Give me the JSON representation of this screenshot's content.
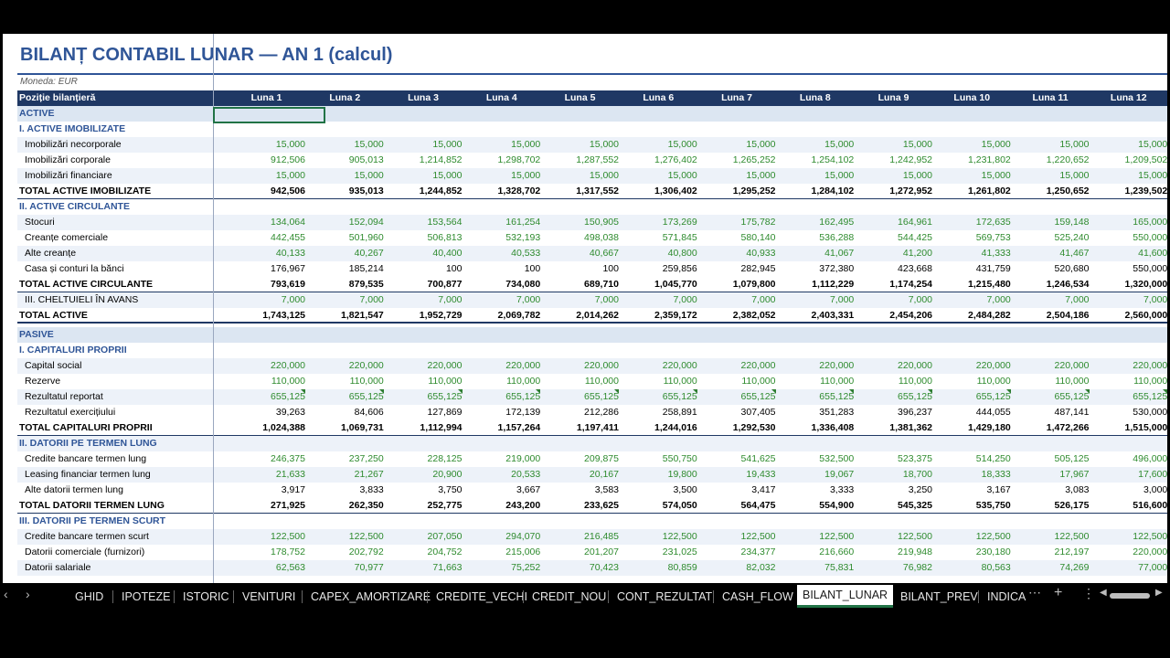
{
  "title": "BILANȚ CONTABIL LUNAR — AN 1 (calcul)",
  "currency": "Moneda: EUR",
  "header_label": "Poziție bilanțieră",
  "months": [
    "Luna 1",
    "Luna 2",
    "Luna 3",
    "Luna 4",
    "Luna 5",
    "Luna 6",
    "Luna 7",
    "Luna 8",
    "Luna 9",
    "Luna 10",
    "Luna 11",
    "Luna 12"
  ],
  "rows": [
    {
      "type": "sec",
      "label": "ACTIVE",
      "values": []
    },
    {
      "type": "sub",
      "label": "I. ACTIVE IMOBILIZATE",
      "values": []
    },
    {
      "type": "inp",
      "band": true,
      "label": "Imobilizări necorporale",
      "values": [
        "15,000",
        "15,000",
        "15,000",
        "15,000",
        "15,000",
        "15,000",
        "15,000",
        "15,000",
        "15,000",
        "15,000",
        "15,000",
        "15,000"
      ]
    },
    {
      "type": "inp",
      "label": "Imobilizări corporale",
      "values": [
        "912,506",
        "905,013",
        "1,214,852",
        "1,298,702",
        "1,287,552",
        "1,276,402",
        "1,265,252",
        "1,254,102",
        "1,242,952",
        "1,231,802",
        "1,220,652",
        "1,209,502"
      ]
    },
    {
      "type": "inp",
      "band": true,
      "label": "Imobilizări financiare",
      "values": [
        "15,000",
        "15,000",
        "15,000",
        "15,000",
        "15,000",
        "15,000",
        "15,000",
        "15,000",
        "15,000",
        "15,000",
        "15,000",
        "15,000"
      ]
    },
    {
      "type": "tot",
      "label": "TOTAL ACTIVE IMOBILIZATE",
      "values": [
        "942,506",
        "935,013",
        "1,244,852",
        "1,328,702",
        "1,317,552",
        "1,306,402",
        "1,295,252",
        "1,284,102",
        "1,272,952",
        "1,261,802",
        "1,250,652",
        "1,239,502"
      ]
    },
    {
      "type": "sub",
      "label": "II. ACTIVE CIRCULANTE",
      "values": []
    },
    {
      "type": "inp",
      "band": true,
      "label": "Stocuri",
      "values": [
        "134,064",
        "152,094",
        "153,564",
        "161,254",
        "150,905",
        "173,269",
        "175,782",
        "162,495",
        "164,961",
        "172,635",
        "159,148",
        "165,000"
      ]
    },
    {
      "type": "inp",
      "label": "Creanțe comerciale",
      "values": [
        "442,455",
        "501,960",
        "506,813",
        "532,193",
        "498,038",
        "571,845",
        "580,140",
        "536,288",
        "544,425",
        "569,753",
        "525,240",
        "550,000"
      ]
    },
    {
      "type": "inp",
      "band": true,
      "label": "Alte creanțe",
      "values": [
        "40,133",
        "40,267",
        "40,400",
        "40,533",
        "40,667",
        "40,800",
        "40,933",
        "41,067",
        "41,200",
        "41,333",
        "41,467",
        "41,600"
      ]
    },
    {
      "type": "calc",
      "label": "Casa și conturi la bănci",
      "values": [
        "176,967",
        "185,214",
        "100",
        "100",
        "100",
        "259,856",
        "282,945",
        "372,380",
        "423,668",
        "431,759",
        "520,680",
        "550,000"
      ]
    },
    {
      "type": "tot",
      "label": "TOTAL ACTIVE CIRCULANTE",
      "values": [
        "793,619",
        "879,535",
        "700,877",
        "734,080",
        "689,710",
        "1,045,770",
        "1,079,800",
        "1,112,229",
        "1,174,254",
        "1,215,480",
        "1,246,534",
        "1,320,000"
      ]
    },
    {
      "type": "inp",
      "band": true,
      "label": "III. CHELTUIELI ÎN AVANS",
      "values": [
        "7,000",
        "7,000",
        "7,000",
        "7,000",
        "7,000",
        "7,000",
        "7,000",
        "7,000",
        "7,000",
        "7,000",
        "7,000",
        "7,000"
      ]
    },
    {
      "type": "tot2",
      "label": "TOTAL ACTIVE",
      "values": [
        "1,743,125",
        "1,821,547",
        "1,952,729",
        "2,069,782",
        "2,014,262",
        "2,359,172",
        "2,382,052",
        "2,403,331",
        "2,454,206",
        "2,484,282",
        "2,504,186",
        "2,560,000"
      ]
    },
    {
      "type": "gap",
      "label": "",
      "values": []
    },
    {
      "type": "sec",
      "label": "PASIVE",
      "values": []
    },
    {
      "type": "sub",
      "label": "I. CAPITALURI PROPRII",
      "values": []
    },
    {
      "type": "inp",
      "band": true,
      "label": "Capital social",
      "values": [
        "220,000",
        "220,000",
        "220,000",
        "220,000",
        "220,000",
        "220,000",
        "220,000",
        "220,000",
        "220,000",
        "220,000",
        "220,000",
        "220,000"
      ]
    },
    {
      "type": "inp",
      "label": "Rezerve",
      "values": [
        "110,000",
        "110,000",
        "110,000",
        "110,000",
        "110,000",
        "110,000",
        "110,000",
        "110,000",
        "110,000",
        "110,000",
        "110,000",
        "110,000"
      ]
    },
    {
      "type": "inp",
      "band": true,
      "tri": true,
      "label": "Rezultatul reportat",
      "values": [
        "655,125",
        "655,125",
        "655,125",
        "655,125",
        "655,125",
        "655,125",
        "655,125",
        "655,125",
        "655,125",
        "655,125",
        "655,125",
        "655,125"
      ]
    },
    {
      "type": "calc",
      "label": "Rezultatul exercițiului",
      "values": [
        "39,263",
        "84,606",
        "127,869",
        "172,139",
        "212,286",
        "258,891",
        "307,405",
        "351,283",
        "396,237",
        "444,055",
        "487,141",
        "530,000"
      ]
    },
    {
      "type": "tot",
      "label": "TOTAL CAPITALURI PROPRII",
      "values": [
        "1,024,388",
        "1,069,731",
        "1,112,994",
        "1,157,264",
        "1,197,411",
        "1,244,016",
        "1,292,530",
        "1,336,408",
        "1,381,362",
        "1,429,180",
        "1,472,266",
        "1,515,000"
      ]
    },
    {
      "type": "sub",
      "band": true,
      "label": "II. DATORII PE TERMEN LUNG",
      "values": []
    },
    {
      "type": "inp",
      "label": "Credite bancare termen lung",
      "values": [
        "246,375",
        "237,250",
        "228,125",
        "219,000",
        "209,875",
        "550,750",
        "541,625",
        "532,500",
        "523,375",
        "514,250",
        "505,125",
        "496,000"
      ]
    },
    {
      "type": "inp",
      "band": true,
      "label": "Leasing financiar termen lung",
      "values": [
        "21,633",
        "21,267",
        "20,900",
        "20,533",
        "20,167",
        "19,800",
        "19,433",
        "19,067",
        "18,700",
        "18,333",
        "17,967",
        "17,600"
      ]
    },
    {
      "type": "calc",
      "label": "Alte datorii termen lung",
      "values": [
        "3,917",
        "3,833",
        "3,750",
        "3,667",
        "3,583",
        "3,500",
        "3,417",
        "3,333",
        "3,250",
        "3,167",
        "3,083",
        "3,000"
      ]
    },
    {
      "type": "tot",
      "label": "TOTAL DATORII TERMEN LUNG",
      "values": [
        "271,925",
        "262,350",
        "252,775",
        "243,200",
        "233,625",
        "574,050",
        "564,475",
        "554,900",
        "545,325",
        "535,750",
        "526,175",
        "516,600"
      ]
    },
    {
      "type": "sub",
      "label": "III. DATORII PE TERMEN SCURT",
      "values": []
    },
    {
      "type": "inp",
      "band": true,
      "label": "Credite bancare termen scurt",
      "values": [
        "122,500",
        "122,500",
        "207,050",
        "294,070",
        "216,485",
        "122,500",
        "122,500",
        "122,500",
        "122,500",
        "122,500",
        "122,500",
        "122,500"
      ]
    },
    {
      "type": "inp",
      "label": "Datorii comerciale (furnizori)",
      "values": [
        "178,752",
        "202,792",
        "204,752",
        "215,006",
        "201,207",
        "231,025",
        "234,377",
        "216,660",
        "219,948",
        "230,180",
        "212,197",
        "220,000"
      ]
    },
    {
      "type": "inp",
      "band": true,
      "label": "Datorii salariale",
      "values": [
        "62,563",
        "70,977",
        "71,663",
        "75,252",
        "70,423",
        "80,859",
        "82,032",
        "75,831",
        "76,982",
        "80,563",
        "74,269",
        "77,000"
      ]
    }
  ],
  "tabs": [
    "GHID",
    "IPOTEZE",
    "ISTORIC",
    "VENITURI",
    "CAPEX_AMORTIZARE",
    "CREDITE_VECHI",
    "CREDIT_NOU",
    "CONT_REZULTAT",
    "CASH_FLOW",
    "BILANT_LUNAR",
    "BILANT_PREV",
    "INDICA"
  ],
  "active_tab": "BILANT_LUNAR",
  "colors": {
    "header_bg": "#1f3864",
    "accent": "#2f5597",
    "input_green": "#2e8b2e",
    "band": "#edf2f9",
    "section_bg": "#dce6f2"
  },
  "icons": {
    "prev": "chevron-left-icon",
    "next": "chevron-right-icon",
    "more": "ellipsis-icon",
    "add": "plus-icon",
    "options": "vertical-ellipsis-icon"
  }
}
